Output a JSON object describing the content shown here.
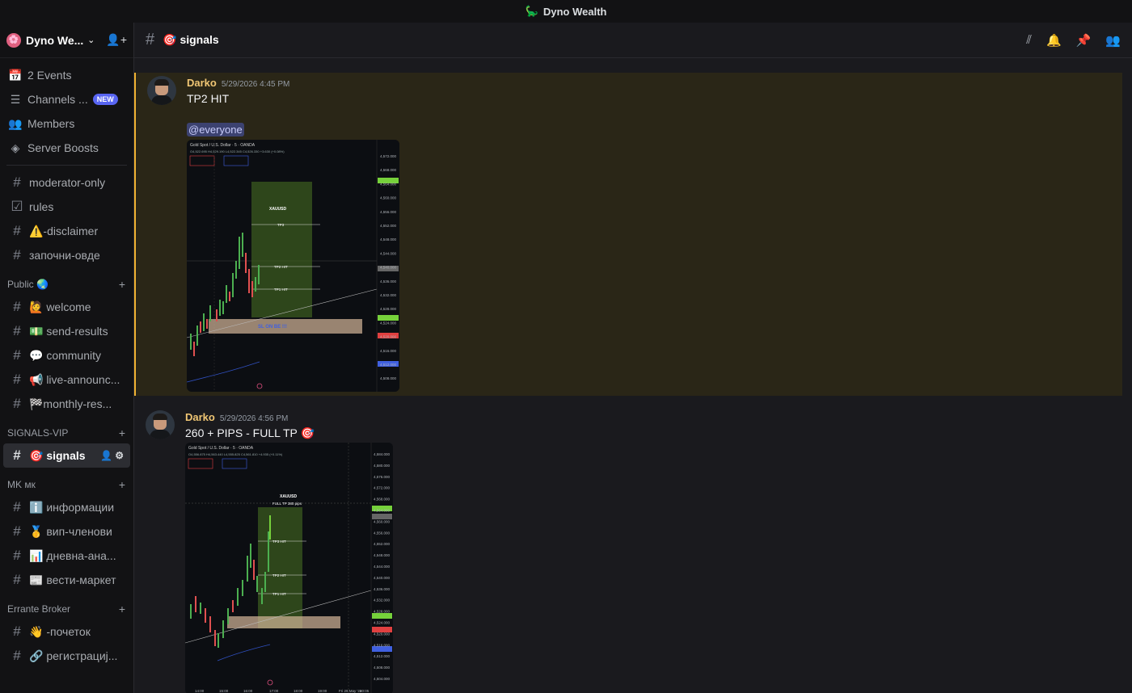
{
  "window": {
    "title": "Dyno Wealth"
  },
  "server": {
    "name": "Dyno We..."
  },
  "nav": {
    "events": "2 Events",
    "channels": "Channels ...",
    "channels_badge": "NEW",
    "members": "Members",
    "boosts": "Server Boosts"
  },
  "top_channels": [
    "moderator-only",
    "rules",
    "⚠️-disclaimer",
    "започни-овде"
  ],
  "categories": {
    "public": "Public 🌏",
    "signals_vip": "SIGNALS-VIP",
    "mk": "MK мк",
    "broker": "Errante Broker"
  },
  "public_channels": [
    "🙋 welcome",
    "💵 send-results",
    "💬 community",
    "📢 live-announc...",
    "🏁monthly-res..."
  ],
  "vip_channels": [
    "🎯 signals"
  ],
  "mk_channels": [
    "ℹ️ информации",
    "🥇 вип-членови",
    "📊 дневна-ана...",
    "📰 вести-маркет"
  ],
  "broker_channels": [
    "👋 -почеток",
    "🔗 регистрациј..."
  ],
  "channel_header": {
    "title": "🎯 signals"
  },
  "messages": [
    {
      "author": "Darko",
      "time": "5/29/2026 4:45 PM",
      "text": "TP2 HIT",
      "mention": "@everyone",
      "chart": {
        "symbol": "Gold Spot / U.S. Dollar · 5 · OANDA",
        "ohlc": "O4,522.695 H4,529.190 L4,522.345 C4,526.330 +3.630 (+0.08%)",
        "label": "XAUUSD",
        "tags": [
          "TP3",
          "TP2 HIT",
          "TP1 HIT"
        ],
        "sl": "SL ON BE !!!",
        "prices": [
          "4,572.000",
          "4,568.000",
          "4,564.000",
          "4,560.000",
          "4,556.000",
          "4,552.000",
          "4,548.000",
          "4,544.000",
          "4,540.000",
          "4,536.000",
          "4,532.000",
          "4,528.000",
          "4,524.000",
          "4,520.000",
          "4,516.000",
          "4,512.000",
          "4,508.000"
        ]
      }
    },
    {
      "author": "Darko",
      "time": "5/29/2026 4:56 PM",
      "text": "260 + PIPS - FULL TP 🎯",
      "chart": {
        "symbol": "Gold Spot / U.S. Dollar · 5 · OANDA",
        "ohlc": "O4,556.875 H4,563.440 L4,555.825 C4,561.810 +4.935 (+0.11%)",
        "label": "XAUUSD",
        "sublabel": "FULL TP 380 pips",
        "tags": [
          "TP3 HIT",
          "TP2 HIT",
          "TP1 HIT"
        ],
        "prices": [
          "4,584.000",
          "4,580.000",
          "4,576.000",
          "4,572.000",
          "4,568.000",
          "4,564.000",
          "4,560.000",
          "4,556.000",
          "4,552.000",
          "4,548.000",
          "4,544.000",
          "4,540.000",
          "4,536.000",
          "4,532.000",
          "4,528.000",
          "4,524.000",
          "4,520.000",
          "4,516.000",
          "4,512.000",
          "4,508.000",
          "4,504.000"
        ],
        "times": [
          "14:00",
          "15:00",
          "16:00",
          "17:00",
          "18:00",
          "19:00",
          "Fri 29 May '26",
          "20:05"
        ]
      }
    }
  ]
}
